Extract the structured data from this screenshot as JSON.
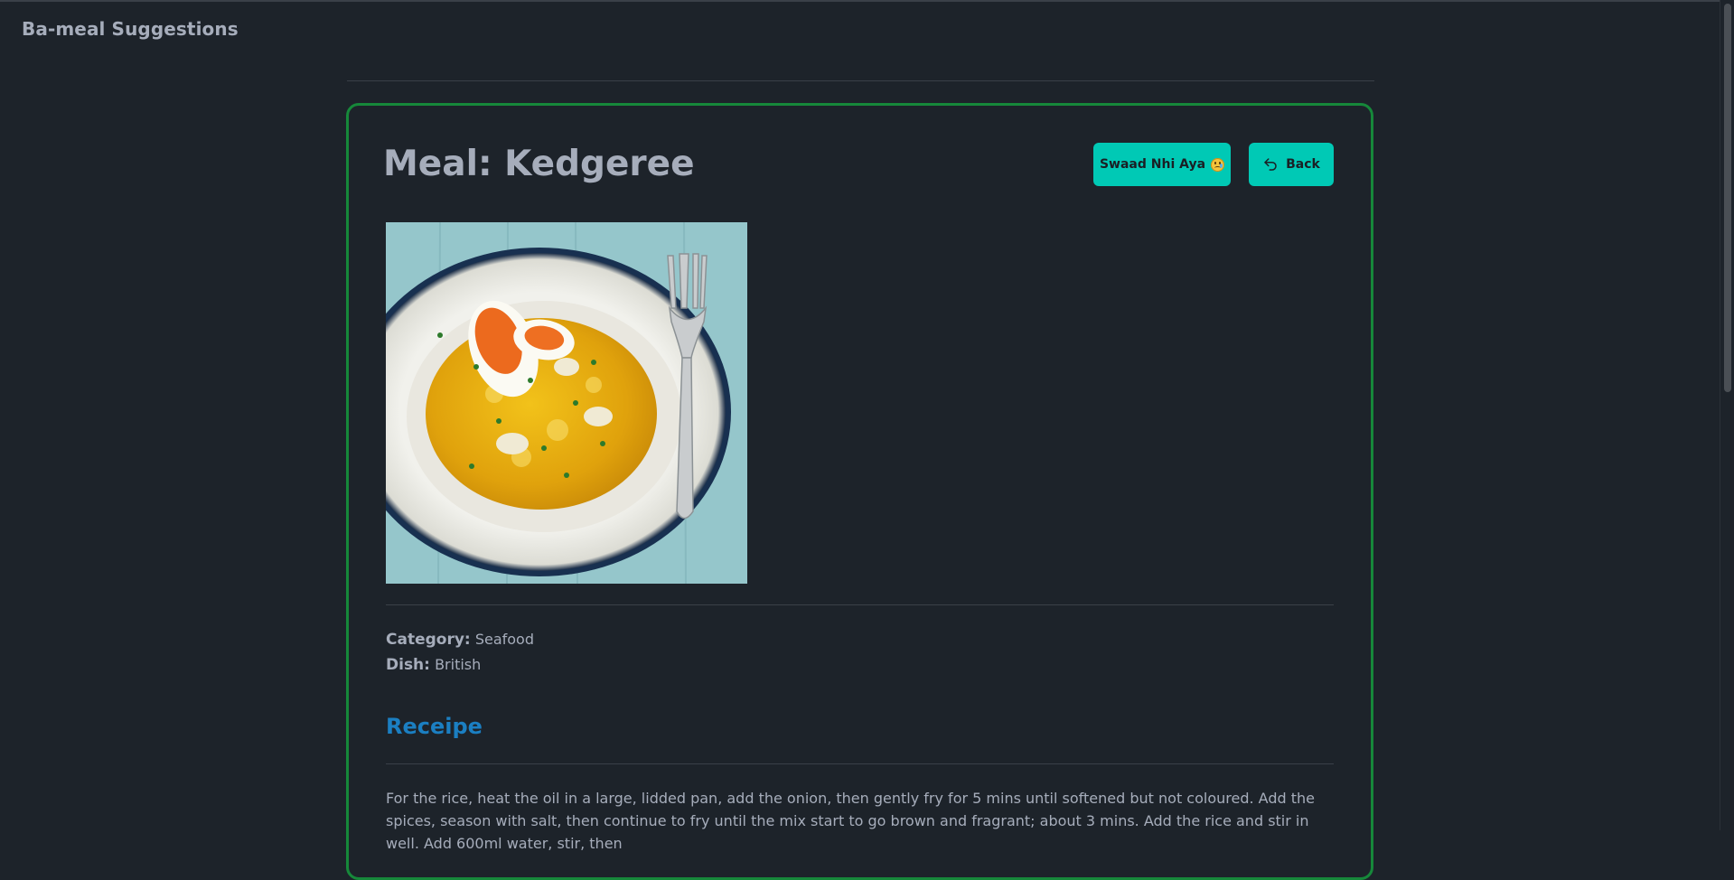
{
  "app": {
    "brand": "Ba-meal Suggestions"
  },
  "meal": {
    "title": "Meal: Kedgeree",
    "category_label": "Category:",
    "category_value": "Seafood",
    "dish_label": "Dish:",
    "dish_value": "British"
  },
  "actions": {
    "swaad_label": "Swaad Nhi Aya",
    "back_label": "Back",
    "back_icon": "undo-arrow-icon",
    "swaad_icon": "crying-face-emoji-icon"
  },
  "recipe": {
    "section_title": "Receipe",
    "instructions": "For the rice, heat the oil in a large, lidded pan, add the onion, then gently fry for 5 mins until softened but not coloured. Add the spices, season with salt, then continue to fry until the mix start to go brown and fragrant; about 3 mins. Add the rice and stir in well. Add 600ml water, stir, then"
  },
  "colors": {
    "background": "#1d232a",
    "card_border": "#16883a",
    "button": "#00c9b5",
    "section_title": "#1b7fc2",
    "text": "#a6adbb"
  }
}
